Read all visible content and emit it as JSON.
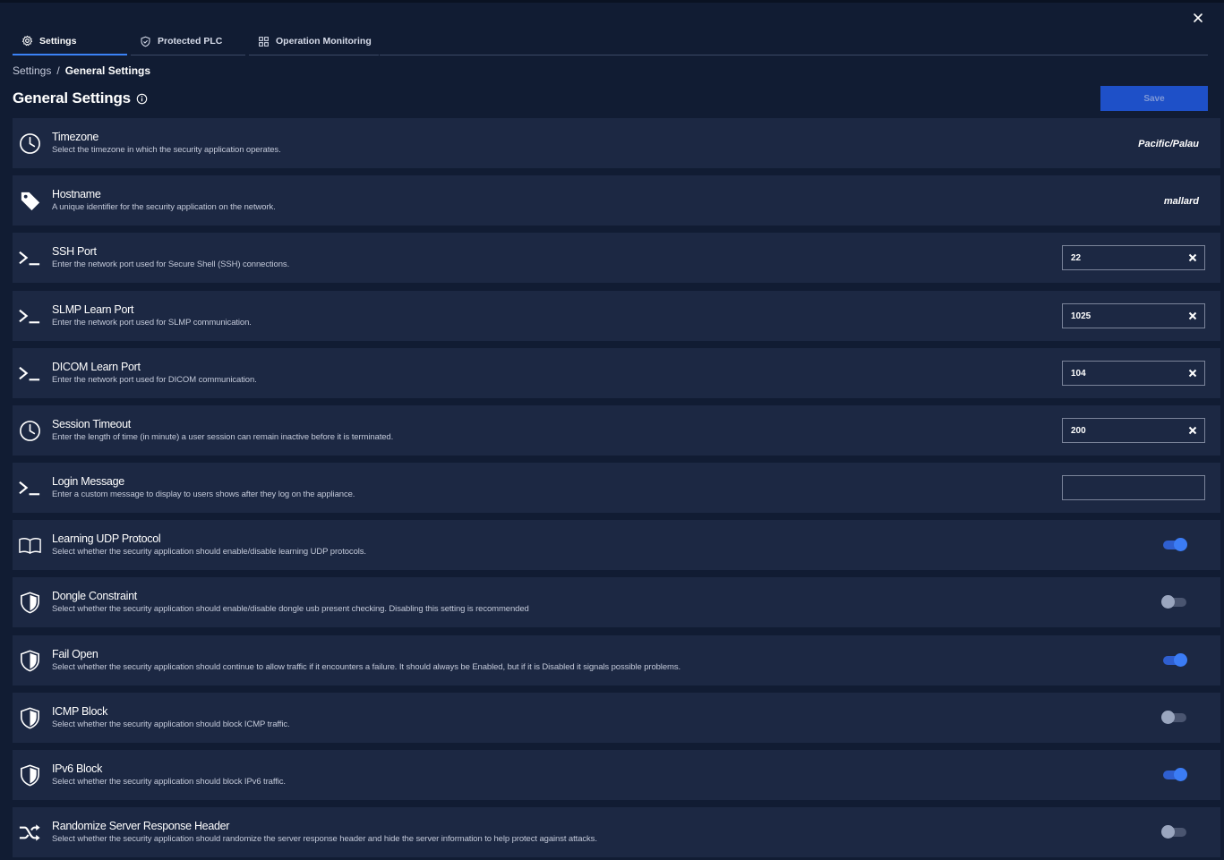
{
  "tabs": [
    {
      "label": "Settings",
      "icon": "gear-icon",
      "active": true
    },
    {
      "label": "Protected PLC",
      "icon": "shield-check-icon",
      "active": false
    },
    {
      "label": "Operation Monitoring",
      "icon": "grid-icon",
      "active": false
    }
  ],
  "breadcrumb": {
    "root": "Settings",
    "separator": "/",
    "current": "General Settings"
  },
  "page": {
    "title": "General Settings",
    "save_label": "Save"
  },
  "colors": {
    "accent": "#3b82f6",
    "background": "#111c33",
    "row": "#1c2843",
    "save": "#1e50c8"
  },
  "settings": [
    {
      "title": "Timezone",
      "description": "Select the timezone in which the security application operates.",
      "icon": "clock-icon",
      "value": "Pacific/Palau"
    },
    {
      "title": "Hostname",
      "description": "A unique identifier for the security application on the network.",
      "icon": "tag-icon",
      "value": "mallard"
    },
    {
      "title": "SSH Port",
      "description": "Enter the network port used for Secure Shell (SSH) connections.",
      "icon": "terminal-icon",
      "input_value": "22"
    },
    {
      "title": "SLMP Learn Port",
      "description": "Enter the network port used for SLMP communication.",
      "icon": "terminal-icon",
      "input_value": "1025"
    },
    {
      "title": "DICOM Learn Port",
      "description": "Enter the network port used for DICOM communication.",
      "icon": "terminal-icon",
      "input_value": "104"
    },
    {
      "title": "Session Timeout",
      "description": "Enter the length of time (in minute) a user session can remain inactive before it is terminated.",
      "icon": "clock-icon",
      "input_value": "200"
    },
    {
      "title": "Login Message",
      "description": "Enter a custom message to display to users shows after they log on the appliance.",
      "icon": "terminal-icon",
      "input_value": ""
    },
    {
      "title": "Learning UDP Protocol",
      "description": "Select whether the security application should enable/disable learning UDP protocols.",
      "icon": "book-icon",
      "enabled": true
    },
    {
      "title": "Dongle Constraint",
      "description": "Select whether the security application should enable/disable dongle usb present checking. Disabling this setting is recommended",
      "icon": "shield-icon",
      "enabled": false
    },
    {
      "title": "Fail Open",
      "description": "Select whether the security application should continue to allow traffic if it encounters a failure. It should always be Enabled, but if it is Disabled it signals possible problems.",
      "icon": "shield-icon",
      "enabled": true
    },
    {
      "title": "ICMP Block",
      "description": "Select whether the security application should block ICMP traffic.",
      "icon": "shield-icon",
      "enabled": false
    },
    {
      "title": "IPv6 Block",
      "description": "Select whether the security application should block IPv6 traffic.",
      "icon": "shield-icon",
      "enabled": true
    },
    {
      "title": "Randomize Server Response Header",
      "description": "Select whether the security application should randomize the server response header and hide the server information to help protect against attacks.",
      "icon": "shuffle-icon",
      "enabled": false
    }
  ]
}
